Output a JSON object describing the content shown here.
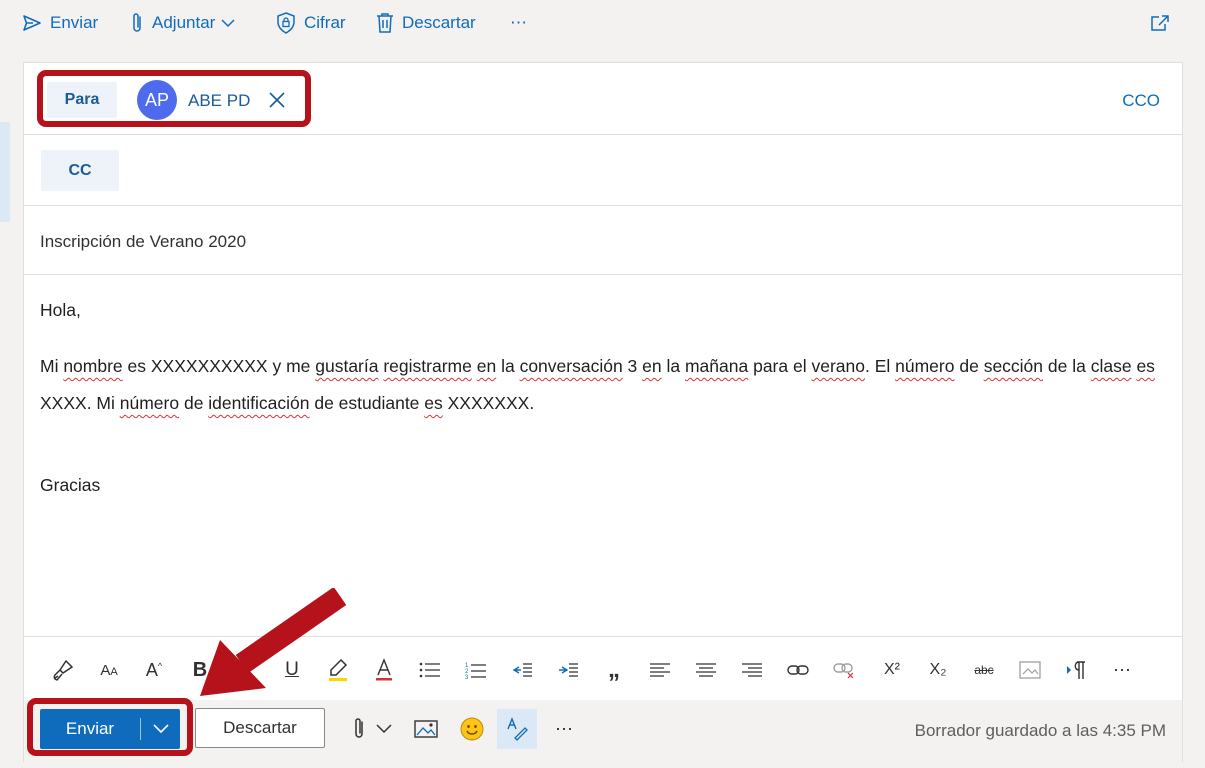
{
  "toolbar": {
    "send": "Enviar",
    "attach": "Adjuntar",
    "encrypt": "Cifrar",
    "discard": "Descartar",
    "more": "⋯"
  },
  "to": {
    "label": "Para",
    "recipient_initials": "AP",
    "recipient_name": "ABE PD",
    "bcc": "CCO"
  },
  "cc": {
    "label": "CC"
  },
  "subject": "Inscripción de Verano 2020",
  "body": {
    "greeting": "Hola,",
    "closing": "Gracias"
  },
  "actions": {
    "send": "Enviar",
    "discard": "Descartar",
    "more": "⋯",
    "draft_status": "Borrador guardado a las 4:35 PM"
  },
  "format": {
    "bold": "B",
    "underline": "U",
    "superscript": "X²",
    "subscript": "X₂",
    "strike": "abc",
    "more": "⋯"
  },
  "colors": {
    "accent": "#0f6cbd",
    "avatar": "#4f6bed",
    "annotation": "#b5121b"
  }
}
